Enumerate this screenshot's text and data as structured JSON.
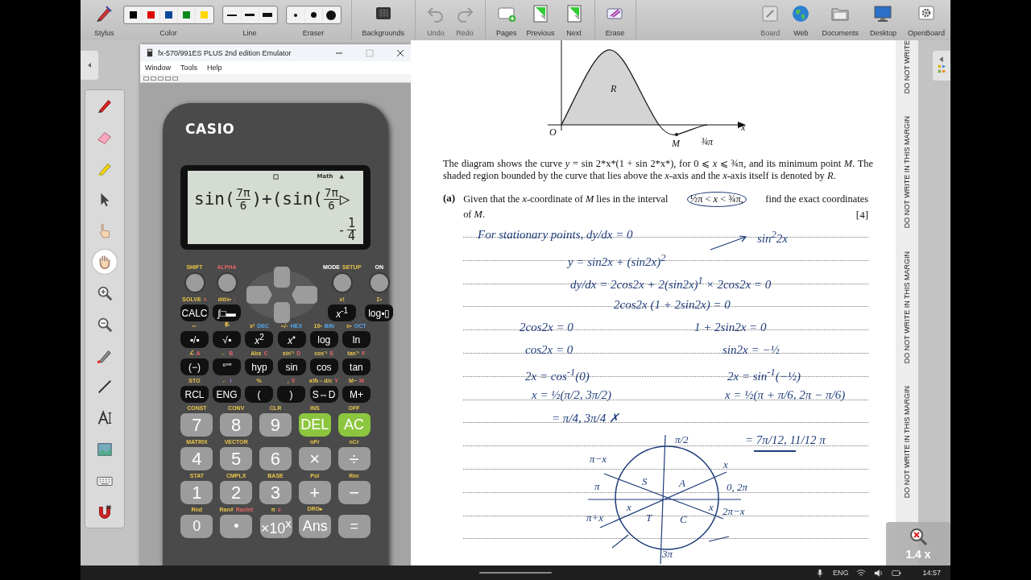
{
  "toolbar": {
    "groups": [
      [
        {
          "kind": "stylus",
          "label": "Stylus",
          "disabled": false
        },
        {
          "kind": "color",
          "label": "Color",
          "disabled": false,
          "colors": [
            {
              "color": "#000000"
            },
            {
              "color": "#e00000"
            },
            {
              "color": "#0b4a9a"
            },
            {
              "color": "#0a8a1a"
            },
            {
              "color": "#ffd800"
            }
          ]
        },
        {
          "kind": "line",
          "label": "Line",
          "disabled": false
        },
        {
          "kind": "eraser",
          "label": "Eraser",
          "disabled": false
        }
      ],
      [
        {
          "kind": "backgrounds",
          "label": "Backgrounds",
          "disabled": false
        }
      ],
      [
        {
          "kind": "undo",
          "label": "Undo",
          "disabled": true
        },
        {
          "kind": "redo",
          "label": "Redo",
          "disabled": true
        }
      ],
      [
        {
          "kind": "pages",
          "label": "Pages",
          "disabled": false
        },
        {
          "kind": "previous",
          "label": "Previous",
          "disabled": false
        },
        {
          "kind": "next",
          "label": "Next",
          "disabled": false
        }
      ],
      [
        {
          "kind": "erase",
          "label": "Erase",
          "disabled": false
        }
      ]
    ],
    "right": [
      {
        "kind": "board",
        "label": "Board",
        "disabled": true
      },
      {
        "kind": "web",
        "label": "Web",
        "disabled": false
      },
      {
        "kind": "documents",
        "label": "Documents",
        "disabled": false
      },
      {
        "kind": "desktop",
        "label": "Desktop",
        "disabled": false
      },
      {
        "kind": "openboard",
        "label": "OpenBoard",
        "disabled": false
      }
    ]
  },
  "tool_palette": [
    {
      "kind": "pen",
      "selected": false
    },
    {
      "kind": "eraser",
      "selected": false
    },
    {
      "kind": "marker",
      "selected": false
    },
    {
      "kind": "pointer",
      "selected": false
    },
    {
      "kind": "pointing",
      "selected": false
    },
    {
      "kind": "hand",
      "selected": true
    },
    {
      "kind": "zoom_in",
      "selected": false
    },
    {
      "kind": "zoom_out",
      "selected": false
    },
    {
      "kind": "laser",
      "selected": false
    },
    {
      "kind": "line",
      "selected": false
    },
    {
      "kind": "text",
      "selected": false
    },
    {
      "kind": "capture",
      "selected": false
    },
    {
      "kind": "keyboard",
      "selected": false
    },
    {
      "kind": "magnet",
      "selected": false
    }
  ],
  "emulator": {
    "title": "fx-570/991ES PLUS 2nd edition Emulator",
    "menu": [
      "Window",
      "Tools",
      "Help"
    ],
    "brand": "CASIO",
    "display": {
      "indicators": [
        "Math",
        "▲"
      ],
      "expression": [
        {
          "kind": "text",
          "text": "sin("
        },
        {
          "kind": "fraction",
          "num": "7π",
          "den": "6"
        },
        {
          "kind": "text",
          "text": ")+(sin("
        },
        {
          "kind": "fraction",
          "num": "7π",
          "den": "6"
        },
        {
          "kind": "text",
          "text": "▷"
        }
      ],
      "result": {
        "sign": "-",
        "num": "1",
        "den": "4"
      }
    },
    "top_row": [
      {
        "above": [
          {
            "text": "SHIFT",
            "kind": "shift"
          }
        ]
      },
      {
        "above": [
          {
            "text": "ALPHA",
            "kind": "alpha"
          }
        ]
      },
      {
        "above": [
          {
            "text": "MODE",
            "kind": "base"
          },
          {
            "text": "SETUP",
            "kind": "shift"
          }
        ]
      },
      {
        "above": [
          {
            "text": "ON",
            "kind": "base"
          }
        ]
      }
    ],
    "nav_row": [
      {
        "label": "CALC",
        "kind": "dark",
        "above": [
          {
            "text": "SOLVE",
            "kind": "shift"
          },
          {
            "text": "=",
            "kind": "alpha"
          }
        ]
      },
      {
        "label": "∫□▬",
        "kind": "dark",
        "above": [
          {
            "text": "d/dx▪",
            "kind": "shift"
          },
          {
            "text": ":",
            "kind": "alpha"
          }
        ]
      },
      {
        "label": "*x*$^{-1}$",
        "kind": "dark",
        "above": [
          {
            "text": "x!",
            "kind": "shift"
          }
        ]
      },
      {
        "label": "log▪▯",
        "kind": "dark",
        "above": [
          {
            "text": "Σ▪",
            "kind": "shift"
          }
        ]
      }
    ],
    "function_rows": [
      [
        {
          "label": "▪/▪",
          "kind": "dark",
          "above": [
            {
              "text": "▪▫",
              "kind": "shift"
            }
          ]
        },
        {
          "label": "√▪",
          "kind": "dark",
          "above": [
            {
              "text": "∛▪",
              "kind": "shift"
            }
          ]
        },
        {
          "label": "*x*$^{2}$",
          "kind": "dark",
          "above": [
            {
              "text": "x³",
              "kind": "shift"
            },
            {
              "text": "DEC",
              "kind": "blue"
            }
          ]
        },
        {
          "label": "*x*$^{▪}$",
          "kind": "dark",
          "above": [
            {
              "text": "▪√▫",
              "kind": "shift"
            },
            {
              "text": "HEX",
              "kind": "blue"
            }
          ]
        },
        {
          "label": "log",
          "kind": "dark",
          "above": [
            {
              "text": "10▪",
              "kind": "shift"
            },
            {
              "text": "BIN",
              "kind": "blue"
            }
          ]
        },
        {
          "label": "ln",
          "kind": "dark",
          "above": [
            {
              "text": "e▪",
              "kind": "shift"
            },
            {
              "text": "OCT",
              "kind": "blue"
            }
          ]
        }
      ],
      [
        {
          "label": "(−)",
          "kind": "dark",
          "above": [
            {
              "text": "∠",
              "kind": "shift"
            },
            {
              "text": "A",
              "kind": "alpha"
            }
          ]
        },
        {
          "label": "°'\"",
          "kind": "dark",
          "above": [
            {
              "text": "←",
              "kind": "shift"
            },
            {
              "text": "B",
              "kind": "alpha"
            }
          ]
        },
        {
          "label": "hyp",
          "kind": "dark",
          "above": [
            {
              "text": "Abs",
              "kind": "shift"
            },
            {
              "text": "C",
              "kind": "alpha"
            }
          ]
        },
        {
          "label": "sin",
          "kind": "dark",
          "above": [
            {
              "text": "sin⁻¹",
              "kind": "shift"
            },
            {
              "text": "D",
              "kind": "alpha"
            }
          ]
        },
        {
          "label": "cos",
          "kind": "dark",
          "above": [
            {
              "text": "cos⁻¹",
              "kind": "shift"
            },
            {
              "text": "E",
              "kind": "alpha"
            }
          ]
        },
        {
          "label": "tan",
          "kind": "dark",
          "above": [
            {
              "text": "tan⁻¹",
              "kind": "shift"
            },
            {
              "text": "F",
              "kind": "alpha"
            }
          ]
        }
      ],
      [
        {
          "label": "RCL",
          "kind": "dark",
          "above": [
            {
              "text": "STO",
              "kind": "shift"
            }
          ]
        },
        {
          "label": "ENG",
          "kind": "dark",
          "above": [
            {
              "text": "←",
              "kind": "shift"
            },
            {
              "text": "i",
              "kind": "purple"
            }
          ]
        },
        {
          "label": "(",
          "kind": "dark",
          "above": [
            {
              "text": "%",
              "kind": "shift"
            }
          ]
        },
        {
          "label": ")",
          "kind": "dark",
          "above": [
            {
              "text": ",",
              "kind": "shift"
            },
            {
              "text": "X",
              "kind": "alpha"
            }
          ]
        },
        {
          "label": "S⇔D",
          "kind": "dark",
          "above": [
            {
              "text": "a⅟b⇔d/c",
              "kind": "shift"
            },
            {
              "text": "Y",
              "kind": "alpha"
            }
          ]
        },
        {
          "label": "M+",
          "kind": "dark",
          "above": [
            {
              "text": "M−",
              "kind": "shift"
            },
            {
              "text": "M",
              "kind": "alpha"
            }
          ]
        }
      ]
    ],
    "number_rows": [
      [
        {
          "label": "7",
          "kind": "gray",
          "above": [
            {
              "text": "CONST",
              "kind": "shift"
            }
          ]
        },
        {
          "label": "8",
          "kind": "gray",
          "above": [
            {
              "text": "CONV",
              "kind": "shift"
            }
          ]
        },
        {
          "label": "9",
          "kind": "gray",
          "above": [
            {
              "text": "CLR",
              "kind": "shift"
            }
          ]
        },
        {
          "label": "DEL",
          "kind": "green",
          "above": [
            {
              "text": "INS",
              "kind": "shift"
            }
          ]
        },
        {
          "label": "AC",
          "kind": "green",
          "above": [
            {
              "text": "OFF",
              "kind": "shift"
            }
          ]
        }
      ],
      [
        {
          "label": "4",
          "kind": "gray",
          "above": [
            {
              "text": "MATRIX",
              "kind": "shift"
            }
          ]
        },
        {
          "label": "5",
          "kind": "gray",
          "above": [
            {
              "text": "VECTOR",
              "kind": "shift"
            }
          ]
        },
        {
          "label": "6",
          "kind": "gray"
        },
        {
          "label": "×",
          "kind": "gray",
          "above": [
            {
              "text": "nPr",
              "kind": "shift"
            }
          ]
        },
        {
          "label": "÷",
          "kind": "gray",
          "above": [
            {
              "text": "nCr",
              "kind": "shift"
            }
          ]
        }
      ],
      [
        {
          "label": "1",
          "kind": "gray",
          "above": [
            {
              "text": "STAT",
              "kind": "shift"
            }
          ]
        },
        {
          "label": "2",
          "kind": "gray",
          "above": [
            {
              "text": "CMPLX",
              "kind": "shift"
            }
          ]
        },
        {
          "label": "3",
          "kind": "gray",
          "above": [
            {
              "text": "BASE",
              "kind": "shift"
            }
          ]
        },
        {
          "label": "+",
          "kind": "gray",
          "above": [
            {
              "text": "Pol",
              "kind": "shift"
            }
          ]
        },
        {
          "label": "−",
          "kind": "gray",
          "above": [
            {
              "text": "Rec",
              "kind": "shift"
            }
          ]
        }
      ],
      [
        {
          "label": "0",
          "kind": "gray",
          "above": [
            {
              "text": "Rnd",
              "kind": "shift"
            }
          ]
        },
        {
          "label": "•",
          "kind": "gray",
          "above": [
            {
              "text": "Ran#",
              "kind": "shift"
            },
            {
              "text": "RanInt",
              "kind": "alpha"
            }
          ]
        },
        {
          "label": "×10$^{x}$",
          "kind": "gray",
          "above": [
            {
              "text": "π",
              "kind": "shift"
            },
            {
              "text": "e",
              "kind": "alpha"
            }
          ]
        },
        {
          "label": "Ans",
          "kind": "gray",
          "above": [
            {
              "text": "DRG▸",
              "kind": "shift"
            }
          ]
        },
        {
          "label": "=",
          "kind": "gray"
        }
      ]
    ]
  },
  "question": {
    "graph_labels": [
      "R",
      "O",
      "M",
      "¾π",
      "x"
    ],
    "intro": "The diagram shows the curve *y* = sin 2*x*(1 + sin 2*x*), for 0 ⩽ *x* ⩽ ¾π, and its minimum point *M*. The shaded region bounded by the curve that lies above the *x*-axis and the *x*-axis itself is denoted by *R*.",
    "part_label": "(a)",
    "part_before": "Given that the *x*-coordinate of *M* lies in the interval ",
    "part_interval": "½π < *x* < ¾π,",
    "part_after": "find the exact coordinates",
    "part_line2": "of *M*.",
    "marks": "[4]"
  },
  "ink": [
    "For stationary points, dy/dx = 0",
    "sin$^{2}$2x",
    "y = sin2x + (sin2x)$^{2}$",
    "dy/dx = 2cos2x + 2(sin2x)$^{1}$ × 2cos2x = 0",
    "2cos2x (1 + 2sin2x) = 0",
    "2cos2x = 0",
    "1 + 2sin2x = 0",
    "cos2x = 0",
    "sin2x = −½",
    "2x = cos$^{-1}$(0)",
    "2x = sin$^{-1}$(−½)",
    "x = ½(π/2, 3π/2)",
    "x = ½(π + π/6, 2π − π/6)",
    "= π/4, 3π/4 ✗",
    "= 7π/12, 11/12 π"
  ],
  "circle_labels": [
    "π/2",
    "π−x",
    "x",
    "π",
    "S",
    "A",
    "0, 2π",
    "π+x",
    "x",
    "T",
    "C",
    "x",
    "2π−x",
    "3π"
  ],
  "margin_notes": [
    "DO NOT WRITE",
    "DO NOT WRITE IN THIS MARGIN",
    "DO NOT WRITE IN THIS MARGIN",
    "DO NOT WRITE IN THIS MARGIN"
  ],
  "zoom": "1.4 x",
  "taskbar": {
    "language": "ENG",
    "time": "14:57"
  }
}
